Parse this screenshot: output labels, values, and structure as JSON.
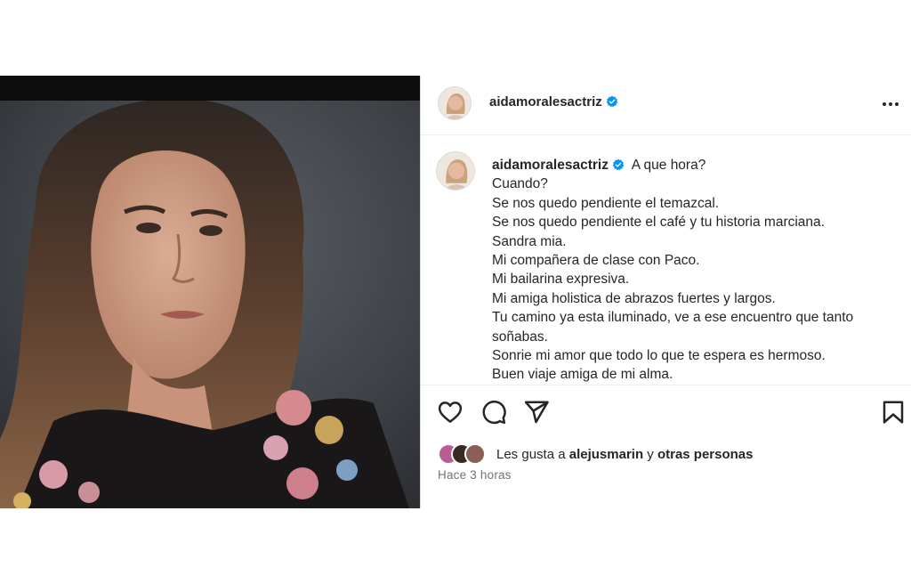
{
  "post": {
    "username": "aidamoralesactriz",
    "verified": true,
    "caption_lines": [
      "A que hora?",
      "Cuando?",
      "Se nos quedo pendiente el temazcal.",
      "Se nos quedo pendiente el café y tu historia marciana.",
      "Sandra mia.",
      "Mi compañera de clase con Paco.",
      "Mi bailarina expresiva.",
      "Mi amiga holistica de abrazos fuertes y largos.",
      "Tu camino ya esta iluminado, ve a ese encuentro que tanto",
      "soñabas.",
      "Sonrie mi amor que todo lo que te espera es hermoso.",
      "Buen viaje amiga de mi alma."
    ]
  },
  "likes": {
    "prefix": "Les gusta a",
    "user": "alejusmarin",
    "joiner": "y",
    "others": "otras personas"
  },
  "timestamp": "Hace 3 horas",
  "icons": {
    "verified": "verified-badge-icon",
    "more": "more-options-icon",
    "like": "heart-icon",
    "comment": "comment-icon",
    "share": "paper-plane-icon",
    "save": "bookmark-icon"
  },
  "colors": {
    "verified_blue": "#0095f6",
    "text": "#262626",
    "secondary": "#737373"
  }
}
